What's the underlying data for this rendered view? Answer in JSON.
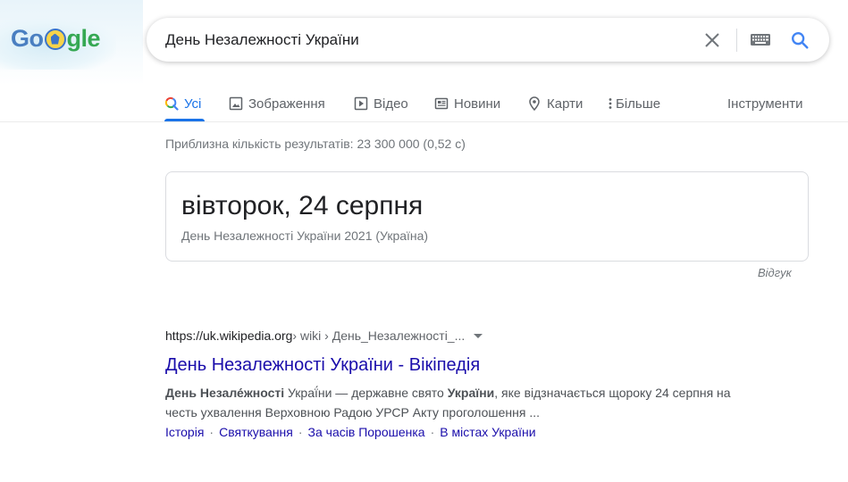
{
  "logo": {
    "text_before": "Go",
    "text_after": "gle",
    "alt": "Google"
  },
  "search": {
    "query": "День Незалежності України"
  },
  "tabs": [
    {
      "label": "Усі",
      "icon": "search-multicolor-icon",
      "active": true
    },
    {
      "label": "Зображення",
      "icon": "image-icon",
      "active": false
    },
    {
      "label": "Відео",
      "icon": "video-icon",
      "active": false
    },
    {
      "label": "Новини",
      "icon": "news-icon",
      "active": false
    },
    {
      "label": "Карти",
      "icon": "map-pin-icon",
      "active": false
    },
    {
      "label": "Більше",
      "icon": "more-vert-icon",
      "active": false
    }
  ],
  "tools_label": "Інструменти",
  "stats": "Приблизна кількість результатів: 23 300 000 (0,52 с)",
  "answer": {
    "date": "вівторок, 24 серпня",
    "subtitle": "День Незалежності України 2021 (Україна)"
  },
  "feedback_label": "Відгук",
  "result": {
    "url_base": "https://uk.wikipedia.org",
    "url_crumbs": " › wiki › День_Незалежності_...",
    "title": "День Незалежності України - Вікіпедія",
    "snippet_b1": "День Незале́жності",
    "snippet_t1": " Украї́ни — державне свято ",
    "snippet_b2": "України",
    "snippet_t2": ", яке відзначається щороку 24 серпня на честь ухвалення Верховною Радою УРСР Акту проголошення ...",
    "sitelinks": [
      "Історія",
      "Святкування",
      "За часів Порошенка",
      "В містах України"
    ]
  },
  "colors": {
    "accent": "#1a73e8",
    "link": "#1a0dab",
    "muted": "#70757a"
  }
}
